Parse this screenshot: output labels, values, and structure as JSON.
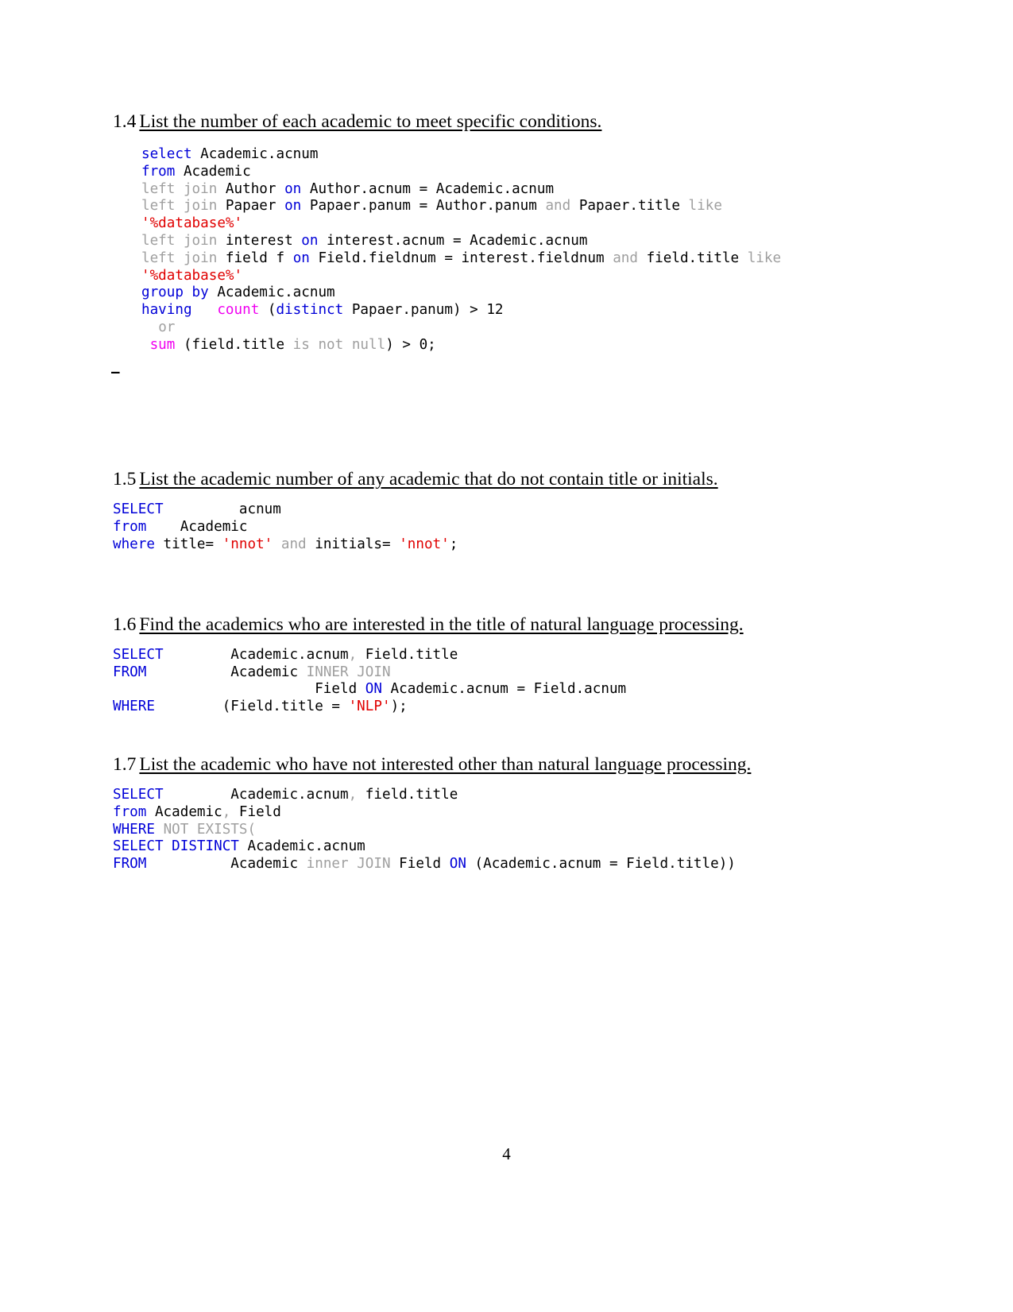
{
  "document": {
    "page_number": "4"
  },
  "sections": [
    {
      "number": "1.4",
      "title": "List the number of each academic to meet specific conditions.",
      "code_lines": [
        [
          {
            "t": "select",
            "c": "kw"
          },
          {
            "t": " Academic.acnum",
            "c": "op"
          }
        ],
        [
          {
            "t": "from",
            "c": "kw"
          },
          {
            "t": " Academic",
            "c": "op"
          }
        ],
        [
          {
            "t": "left join",
            "c": "dim"
          },
          {
            "t": " Author ",
            "c": "op"
          },
          {
            "t": "on",
            "c": "kw"
          },
          {
            "t": " Author.acnum = Academic.acnum",
            "c": "op"
          }
        ],
        [
          {
            "t": "left join",
            "c": "dim"
          },
          {
            "t": " Papaer ",
            "c": "op"
          },
          {
            "t": "on",
            "c": "kw"
          },
          {
            "t": " Papaer.panum = Author.panum ",
            "c": "op"
          },
          {
            "t": "and",
            "c": "dim"
          },
          {
            "t": " Papaer.title ",
            "c": "op"
          },
          {
            "t": "like",
            "c": "dim"
          }
        ],
        [
          {
            "t": "'%database%'",
            "c": "str"
          }
        ],
        [
          {
            "t": "left join",
            "c": "dim"
          },
          {
            "t": " interest ",
            "c": "op"
          },
          {
            "t": "on",
            "c": "kw"
          },
          {
            "t": " interest.acnum = Academic.acnum",
            "c": "op"
          }
        ],
        [
          {
            "t": "left join",
            "c": "dim"
          },
          {
            "t": " field f ",
            "c": "op"
          },
          {
            "t": "on",
            "c": "kw"
          },
          {
            "t": " Field.fieldnum = interest.fieldnum ",
            "c": "op"
          },
          {
            "t": "and",
            "c": "dim"
          },
          {
            "t": " field.title ",
            "c": "op"
          },
          {
            "t": "like",
            "c": "dim"
          }
        ],
        [
          {
            "t": "'%database%'",
            "c": "str"
          }
        ],
        [
          {
            "t": "group by",
            "c": "kw"
          },
          {
            "t": " Academic.acnum",
            "c": "op"
          }
        ],
        [
          {
            "t": "having",
            "c": "kw"
          },
          {
            "t": "   ",
            "c": "op"
          },
          {
            "t": "count",
            "c": "fn"
          },
          {
            "t": " (",
            "c": "op"
          },
          {
            "t": "distinct",
            "c": "kw"
          },
          {
            "t": " Papaer.panum) > 12",
            "c": "op"
          }
        ],
        [
          {
            "t": "  ",
            "c": "op"
          },
          {
            "t": "or",
            "c": "dim"
          }
        ],
        [
          {
            "t": " ",
            "c": "op"
          },
          {
            "t": "sum",
            "c": "fn"
          },
          {
            "t": " (field.title ",
            "c": "op"
          },
          {
            "t": "is not null",
            "c": "dim"
          },
          {
            "t": ") > 0;",
            "c": "op"
          }
        ]
      ],
      "trailing_dash": "–"
    },
    {
      "number": "1.5",
      "title": "List the academic number of any academic that do not contain title or initials.",
      "code_lines": [
        [
          {
            "t": "SELECT",
            "c": "kw"
          },
          {
            "t": "         acnum",
            "c": "op"
          }
        ],
        [
          {
            "t": "from",
            "c": "kw"
          },
          {
            "t": "    Academic",
            "c": "op"
          }
        ],
        [
          {
            "t": "where",
            "c": "kw"
          },
          {
            "t": " title= ",
            "c": "op"
          },
          {
            "t": "'nnot'",
            "c": "str"
          },
          {
            "t": " ",
            "c": "op"
          },
          {
            "t": "and",
            "c": "dim"
          },
          {
            "t": " initials= ",
            "c": "op"
          },
          {
            "t": "'nnot'",
            "c": "str"
          },
          {
            "t": ";",
            "c": "op"
          }
        ]
      ]
    },
    {
      "number": "1.6",
      "title": "Find the academics who are interested in the title of natural language processing. ",
      "code_lines": [
        [
          {
            "t": "SELECT",
            "c": "kw"
          },
          {
            "t": "        Academic.acnum",
            "c": "op"
          },
          {
            "t": ",",
            "c": "dim"
          },
          {
            "t": " Field.title",
            "c": "op"
          }
        ],
        [
          {
            "t": "FROM",
            "c": "kw"
          },
          {
            "t": "          Academic ",
            "c": "op"
          },
          {
            "t": "INNER JOIN",
            "c": "dim"
          }
        ],
        [
          {
            "t": "                        Field ",
            "c": "op"
          },
          {
            "t": "ON",
            "c": "kw"
          },
          {
            "t": " Academic.acnum = Field.acnum",
            "c": "op"
          }
        ],
        [
          {
            "t": "WHERE",
            "c": "kw"
          },
          {
            "t": "        (Field.title = ",
            "c": "op"
          },
          {
            "t": "'NLP'",
            "c": "str"
          },
          {
            "t": ");",
            "c": "op"
          }
        ]
      ]
    },
    {
      "number": "1.7",
      "title": "List the academic who have not interested other than natural language processing. ",
      "code_lines": [
        [
          {
            "t": "SELECT",
            "c": "kw"
          },
          {
            "t": "        Academic.acnum",
            "c": "op"
          },
          {
            "t": ",",
            "c": "dim"
          },
          {
            "t": " field.title",
            "c": "op"
          }
        ],
        [
          {
            "t": "from",
            "c": "kw"
          },
          {
            "t": " Academic",
            "c": "op"
          },
          {
            "t": ",",
            "c": "dim"
          },
          {
            "t": " Field",
            "c": "op"
          }
        ],
        [
          {
            "t": "WHERE",
            "c": "kw"
          },
          {
            "t": " ",
            "c": "op"
          },
          {
            "t": "NOT EXISTS(",
            "c": "dim"
          }
        ],
        [
          {
            "t": "SELECT DISTINCT",
            "c": "kw"
          },
          {
            "t": " Academic.acnum",
            "c": "op"
          }
        ],
        [
          {
            "t": "FROM",
            "c": "kw"
          },
          {
            "t": "          Academic ",
            "c": "op"
          },
          {
            "t": "inner JOIN",
            "c": "dim"
          },
          {
            "t": " Field ",
            "c": "op"
          },
          {
            "t": "ON",
            "c": "kw"
          },
          {
            "t": " (Academic.acnum = Field.title))",
            "c": "op"
          }
        ]
      ]
    }
  ],
  "colors": {
    "keyword_blue": "#0000d8",
    "dim_gray": "#9f9f9f",
    "string_red": "#e00000",
    "function_magenta": "#f000f0",
    "text_black": "#000000",
    "background": "#ffffff"
  }
}
